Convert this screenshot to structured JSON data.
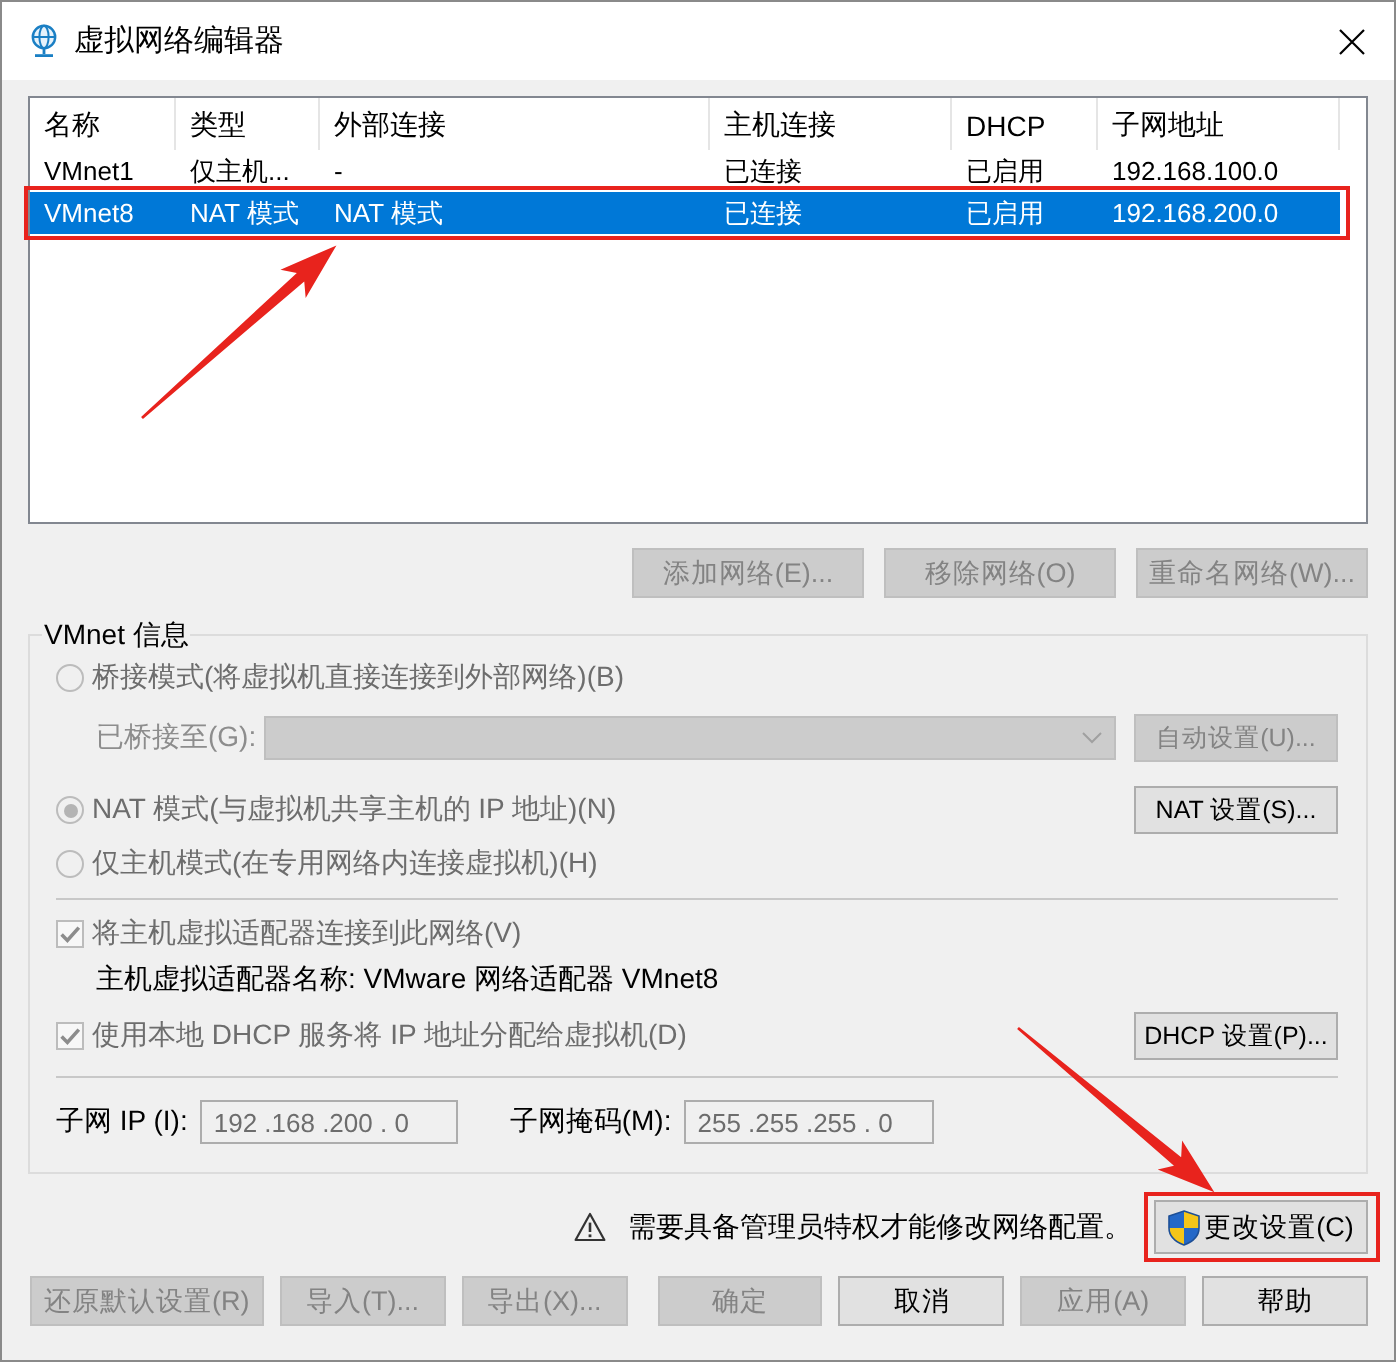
{
  "window": {
    "title": "虚拟网络编辑器"
  },
  "network_table": {
    "columns": [
      "名称",
      "类型",
      "外部连接",
      "主机连接",
      "DHCP",
      "子网地址"
    ],
    "rows": [
      {
        "cells": [
          "VMnet1",
          "仅主机...",
          "-",
          "已连接",
          "已启用",
          "192.168.100.0"
        ],
        "selected": false,
        "highlighted": false
      },
      {
        "cells": [
          "VMnet8",
          "NAT 模式",
          "NAT 模式",
          "已连接",
          "已启用",
          "192.168.200.0"
        ],
        "selected": true,
        "highlighted": true
      }
    ]
  },
  "table_buttons": [
    {
      "label": "添加网络(E)...",
      "disabled": true
    },
    {
      "label": "移除网络(O)",
      "disabled": true
    },
    {
      "label": "重命名网络(W)...",
      "disabled": true
    }
  ],
  "vmnet_info": {
    "title": "VMnet 信息",
    "modes": [
      {
        "label": "桥接模式(将虚拟机直接连接到外部网络)(B)",
        "selected": false,
        "disabled": true
      },
      {
        "label": "NAT 模式(与虚拟机共享主机的 IP 地址)(N)",
        "selected": true,
        "disabled": true,
        "button": {
          "label": "NAT 设置(S)...",
          "disabled": false
        }
      },
      {
        "label": "仅主机模式(在专用网络内连接虚拟机)(H)",
        "selected": false,
        "disabled": true
      }
    ],
    "bridged_to": {
      "label": "已桥接至(G):",
      "disabled": true,
      "button": {
        "label": "自动设置(U)...",
        "disabled": true
      }
    },
    "options": [
      {
        "label": "将主机虚拟适配器连接到此网络(V)",
        "checked": true,
        "disabled": true,
        "note": "主机虚拟适配器名称: VMware 网络适配器 VMnet8"
      },
      {
        "label": "使用本地 DHCP 服务将 IP 地址分配给虚拟机(D)",
        "checked": true,
        "disabled": true,
        "button": {
          "label": "DHCP 设置(P)...",
          "disabled": false
        }
      }
    ],
    "subnet_ip": {
      "label": "子网 IP (I):",
      "value": "192 .168 .200 . 0",
      "disabled": true
    },
    "subnet_mask": {
      "label": "子网掩码(M):",
      "value": "255 .255 .255 . 0",
      "disabled": true
    }
  },
  "admin_notice": {
    "text": "需要具备管理员特权才能修改网络配置。"
  },
  "change_settings_button": {
    "label": "更改设置(C)",
    "highlighted": true
  },
  "footer_buttons": [
    {
      "label": "还原默认设置(R)",
      "disabled": true
    },
    {
      "label": "导入(T)...",
      "disabled": true
    },
    {
      "label": "导出(X)...",
      "disabled": true
    },
    {
      "label": "确定",
      "disabled": true
    },
    {
      "label": "取消",
      "disabled": false
    },
    {
      "label": "应用(A)",
      "disabled": true
    },
    {
      "label": "帮助",
      "disabled": false
    }
  ]
}
